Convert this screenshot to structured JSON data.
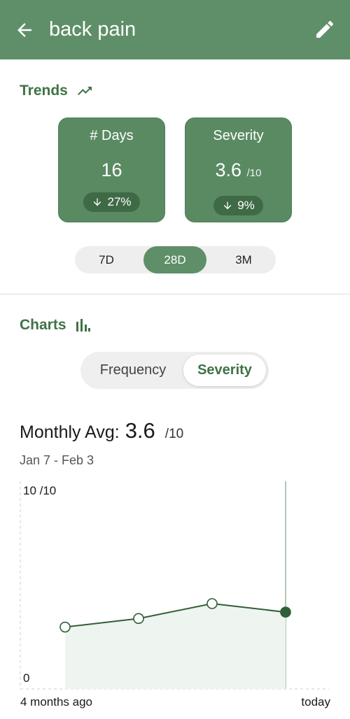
{
  "appbar": {
    "title": "back pain",
    "back_icon": "arrow-left-icon",
    "edit_icon": "pencil-icon"
  },
  "trends": {
    "title": "Trends",
    "icon": "trending-up-icon",
    "cards": [
      {
        "label": "# Days",
        "value": "16",
        "unit": "",
        "change": "27%",
        "change_icon": "arrow-down-icon"
      },
      {
        "label": "Severity",
        "value": "3.6",
        "unit": "/10",
        "change": "9%",
        "change_icon": "arrow-down-icon"
      }
    ],
    "ranges": [
      "7D",
      "28D",
      "3M"
    ],
    "selected_range": "28D"
  },
  "charts": {
    "title": "Charts",
    "icon": "bar-chart-icon",
    "tabs": [
      "Frequency",
      "Severity"
    ],
    "selected_tab": "Severity",
    "avg_label": "Monthly Avg:",
    "avg_value": "3.6",
    "avg_unit": "/10",
    "date_range": "Jan 7 - Feb 3"
  },
  "colors": {
    "primary": "#5f8f68",
    "card": "#5a8a62",
    "chip": "#3f6a46",
    "accent_text": "#3f7346",
    "line": "#2f5f36"
  },
  "chart_data": {
    "type": "line",
    "x": [
      "4 months ago",
      "",
      "",
      "today"
    ],
    "series": [
      {
        "values": [
          2.9,
          3.3,
          4.0,
          3.6
        ]
      }
    ],
    "ylim": [
      0,
      10
    ],
    "y_top_label": "10 /10",
    "y_bottom_label": "0",
    "x_start_label": "4 months ago",
    "x_end_label": "today",
    "highlight_last": true
  }
}
